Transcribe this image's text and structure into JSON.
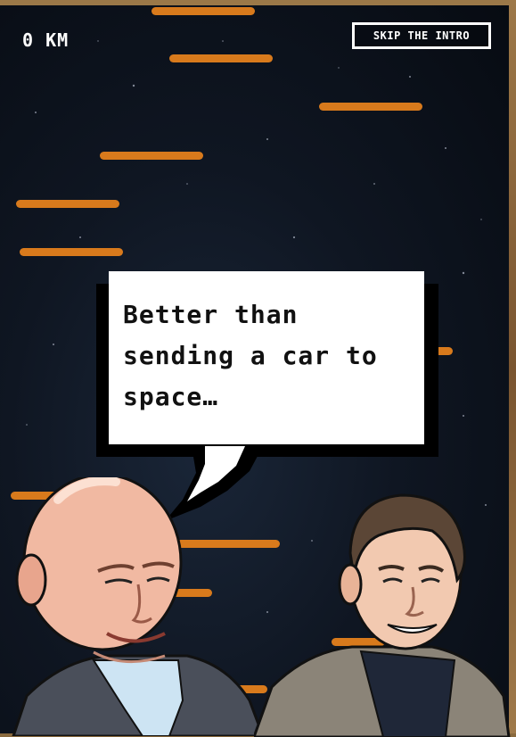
{
  "hud": {
    "distance_label": "0 KM",
    "skip_label": "SKIP THE INTRO"
  },
  "dialog": {
    "text": "Better than sending a car to space…"
  },
  "colors": {
    "streak": "#d87a1c",
    "space": "#0f1622",
    "bubble": "#ffffff"
  },
  "characters": [
    "bald-man-character",
    "dark-haired-man-character"
  ]
}
